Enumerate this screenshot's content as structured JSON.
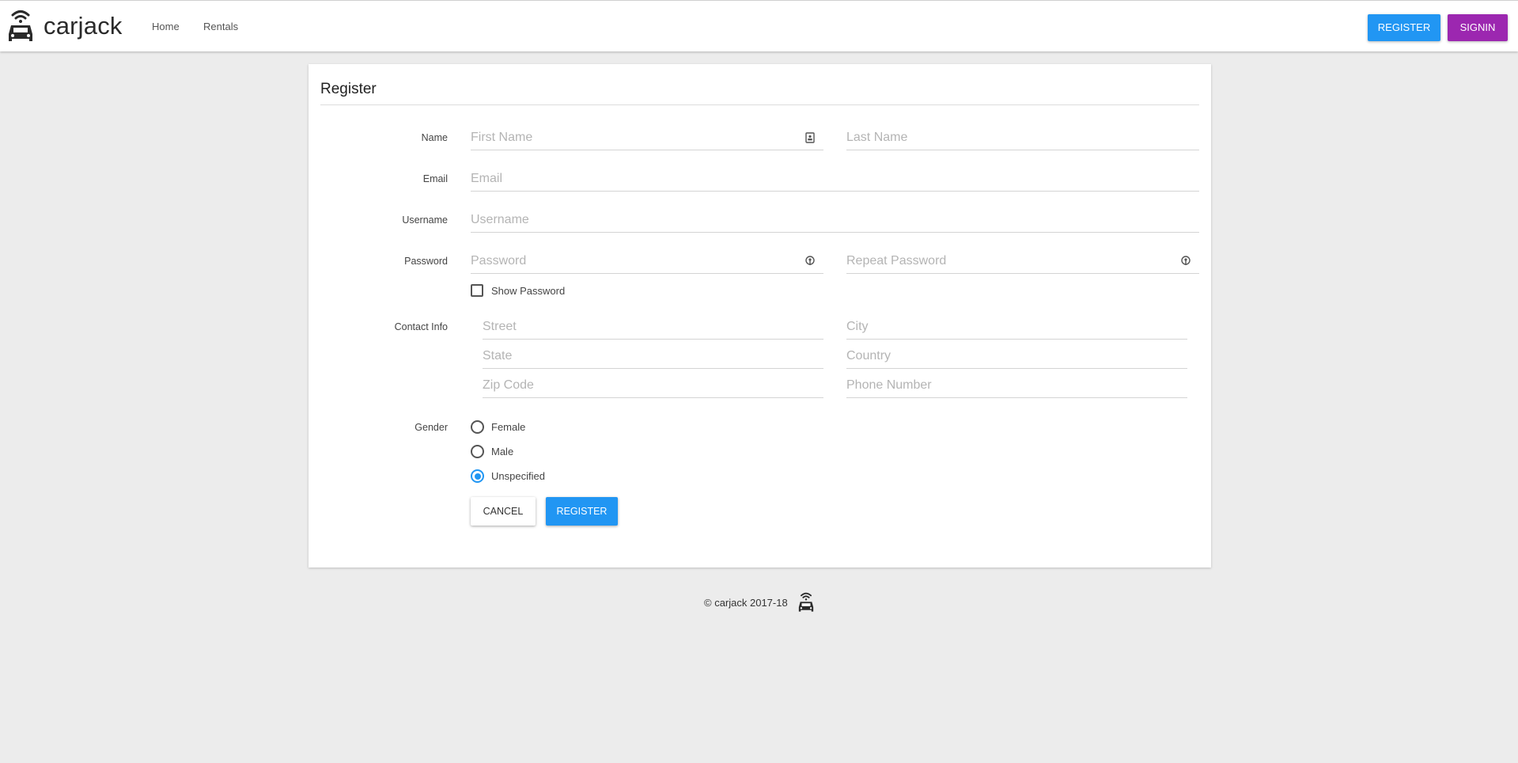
{
  "app": {
    "brand": "carjack",
    "nav": [
      {
        "label": "Home"
      },
      {
        "label": "Rentals"
      }
    ],
    "top_buttons": {
      "register": "REGISTER",
      "signin": "SIGNIN"
    }
  },
  "colors": {
    "primary": "#2196f3",
    "signin": "#9c27b0",
    "background": "#ececec"
  },
  "form": {
    "title": "Register",
    "labels": {
      "name": "Name",
      "email": "Email",
      "username": "Username",
      "password": "Password",
      "contact": "Contact Info",
      "gender": "Gender"
    },
    "fields": {
      "first_name": {
        "placeholder": "First Name",
        "value": "",
        "icon": "contact-card-icon"
      },
      "last_name": {
        "placeholder": "Last Name",
        "value": ""
      },
      "email": {
        "placeholder": "Email",
        "value": ""
      },
      "username": {
        "placeholder": "Username",
        "value": ""
      },
      "password": {
        "placeholder": "Password",
        "value": "",
        "icon": "password-key-icon"
      },
      "repeat_password": {
        "placeholder": "Repeat Password",
        "value": "",
        "icon": "password-key-icon"
      },
      "street": {
        "placeholder": "Street",
        "value": ""
      },
      "city": {
        "placeholder": "City",
        "value": ""
      },
      "state": {
        "placeholder": "State",
        "value": ""
      },
      "country": {
        "placeholder": "Country",
        "value": ""
      },
      "zip": {
        "placeholder": "Zip Code",
        "value": ""
      },
      "phone": {
        "placeholder": "Phone Number",
        "value": ""
      }
    },
    "show_password": {
      "label": "Show Password",
      "checked": false
    },
    "gender_options": [
      {
        "label": "Female",
        "checked": false
      },
      {
        "label": "Male",
        "checked": false
      },
      {
        "label": "Unspecified",
        "checked": true
      }
    ],
    "buttons": {
      "cancel": "CANCEL",
      "register": "REGISTER"
    }
  },
  "footer": {
    "text": "© carjack 2017-18",
    "icon": "car-wifi-icon"
  }
}
